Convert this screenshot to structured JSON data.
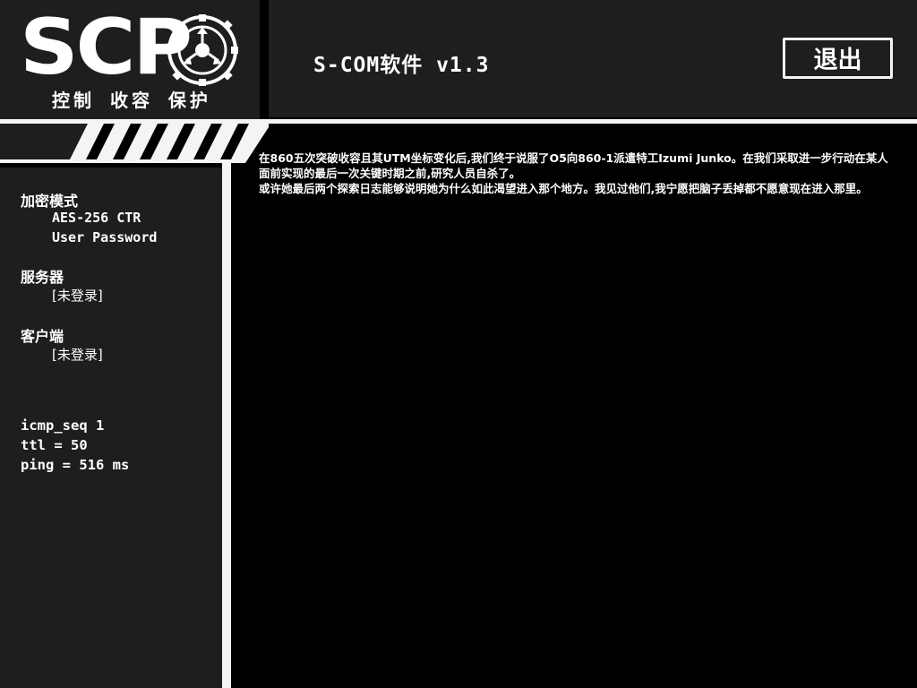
{
  "logo": {
    "wordmark": "SCP",
    "motto": "控制 收容 保护",
    "emblem_icon": "scp-foundation-emblem-icon"
  },
  "header": {
    "title": "S-COM软件 v1.3",
    "exit_label": "退出"
  },
  "sidebar": {
    "encryption": {
      "heading": "加密模式",
      "cipher": "AES-256 CTR",
      "auth": "User Password"
    },
    "server": {
      "heading": "服务器",
      "status": "[未登录]"
    },
    "client": {
      "heading": "客户端",
      "status": "[未登录]"
    },
    "network": {
      "icmp_seq": "icmp_seq 1",
      "ttl": "ttl = 50",
      "ping": "ping = 516 ms"
    }
  },
  "log": {
    "lines": [
      "在860五次突破收容且其UTM坐标变化后,我们终于说服了O5向860-1派遣特工Izumi Junko。在我们采取进一步行动在某人面前实现的最后一次关键时期之前,研究人员自杀了。",
      "或许她最后两个探索日志能够说明她为什么如此渴望进入那个地方。我见过他们,我宁愿把脑子丢掉都不愿意现在进入那里。"
    ]
  },
  "colors": {
    "panel": "#1e1e1e",
    "accent": "#f4f4f4",
    "background": "#000000"
  }
}
